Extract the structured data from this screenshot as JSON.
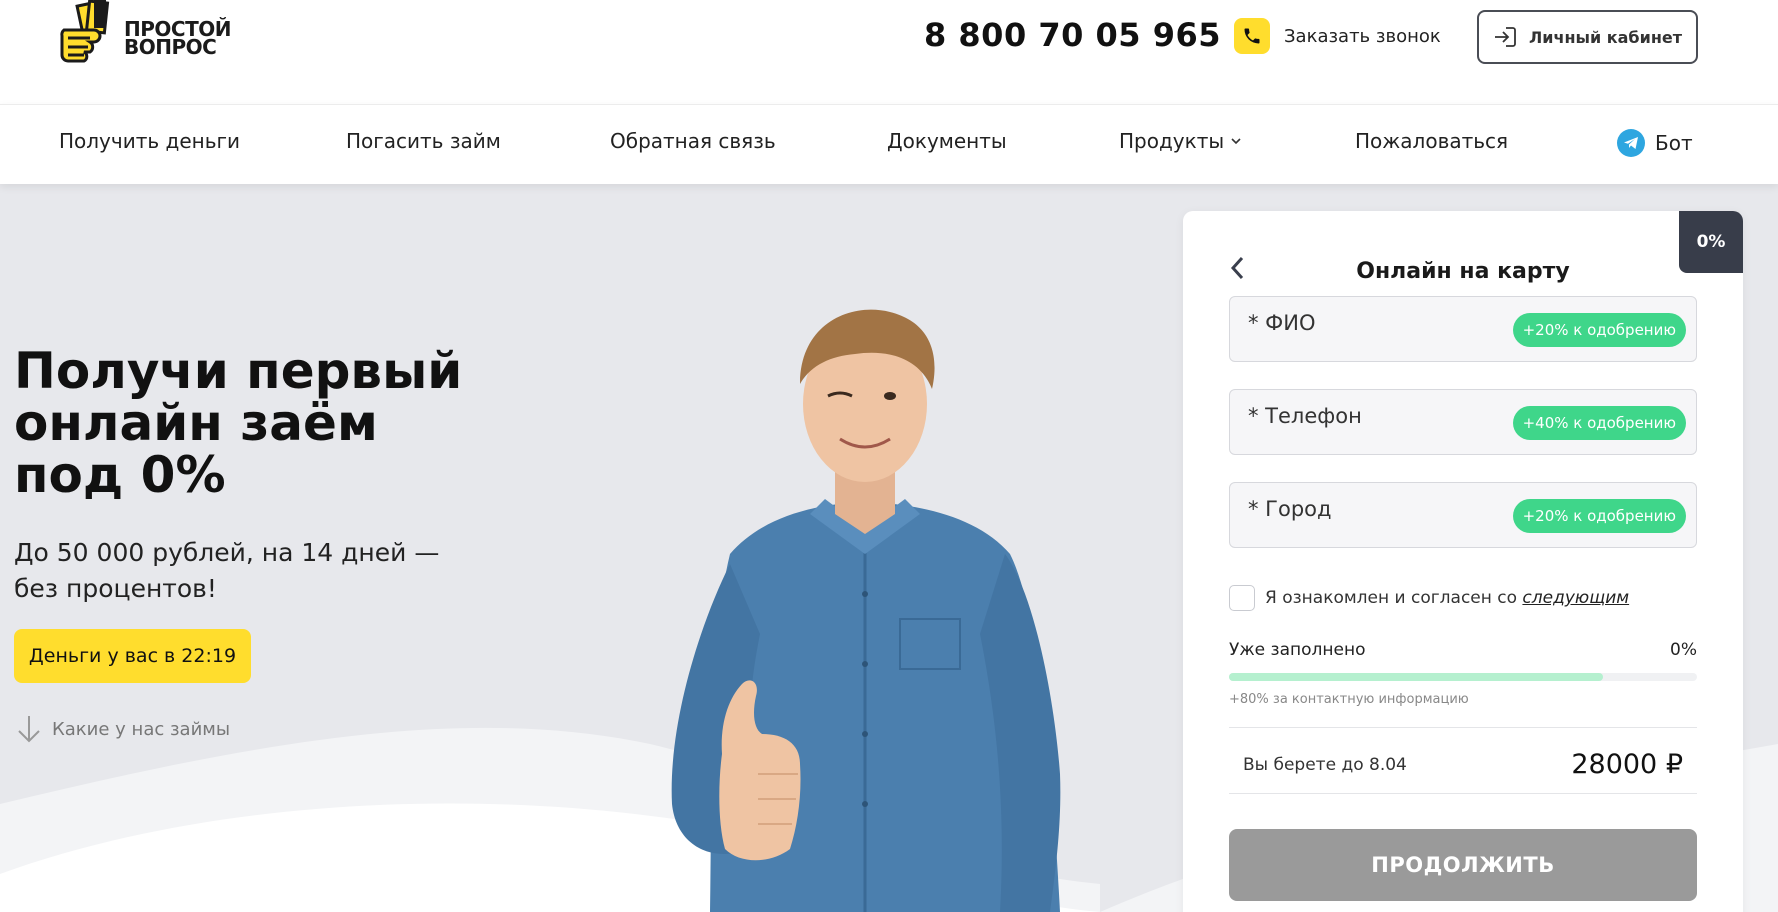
{
  "header": {
    "logo_line1": "ПРОСТОЙ",
    "logo_line2": "ВОПРОС",
    "phone": "8 800 70 05 965",
    "callback_label": "Заказать звонок",
    "cabinet_label": "Личный кабинет"
  },
  "nav": {
    "items": [
      {
        "label": "Получить деньги"
      },
      {
        "label": "Погасить займ"
      },
      {
        "label": "Обратная связь"
      },
      {
        "label": "Документы"
      },
      {
        "label": "Продукты"
      },
      {
        "label": "Пожаловаться"
      },
      {
        "label": "Бот"
      }
    ]
  },
  "hero": {
    "title": "Получи первый онлайн заём под 0%",
    "subtitle": "До 50 000 рублей, на 14 дней — без процентов!",
    "money_button": "Деньги у вас в 22:19",
    "loans_link": "Какие у нас займы"
  },
  "form": {
    "badge": "0%",
    "title": "Онлайн на карту",
    "fields": [
      {
        "label": "* ФИО",
        "badge": "+20% к одобрению"
      },
      {
        "label": "* Телефон",
        "badge": "+40% к одобрению"
      },
      {
        "label": "* Город",
        "badge": "+20% к одобрению"
      }
    ],
    "agree_text": "Я ознакомлен и согласен со ",
    "agree_link": "следующим",
    "filled_label": "Уже заполнено",
    "filled_value": "0%",
    "progress_fraction": 0.8,
    "progress_note": "+80% за контактную информацию",
    "take_label": "Вы берете до 8.04",
    "take_amount": "28000 ₽",
    "continue_label": "ПРОДОЛЖИТЬ"
  },
  "colors": {
    "brand_yellow": "#ffdd2d",
    "badge_green": "#3fd68a",
    "progress_green": "#b5f0cf",
    "dark_badge": "#383d4a",
    "disabled_button": "#9a9a9a",
    "hero_bg": "#e7e8ec",
    "telegram_blue": "#2ea6e0"
  },
  "icons": {
    "logo": "hand-with-banknotes-logo",
    "callback": "phone-icon",
    "cabinet": "login-icon",
    "nav_chevron": "chevron-down-icon",
    "telegram": "telegram-icon",
    "loans": "arrow-down-icon",
    "back": "chevron-left-icon"
  }
}
